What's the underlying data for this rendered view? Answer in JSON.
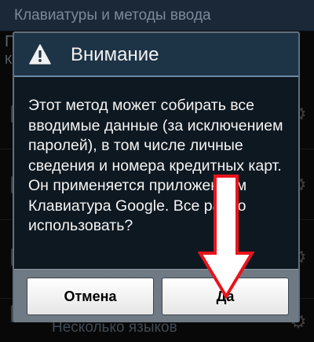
{
  "background": {
    "title": "Клавиатуры и методы ввода",
    "rows": [
      {
        "fragment": "П"
      },
      {
        "fragment": "К"
      },
      {
        "label": "Несколько языков"
      }
    ]
  },
  "dialog": {
    "title": "Внимание",
    "icon": "warning-icon",
    "message": "Этот метод может собирать все вводимые данные (за исключением паролей), в том числе личные сведения и номера кредитных карт. Он применяется приложением Клавиатура Google. Все равно использовать?",
    "cancel_label": "Отмена",
    "ok_label": "Да"
  },
  "annotation": {
    "type": "arrow-down",
    "color": "#e8141b"
  },
  "colors": {
    "dialog_header": "#1d3346",
    "dialog_body": "#0e1821",
    "footer": "#6f7a84"
  }
}
